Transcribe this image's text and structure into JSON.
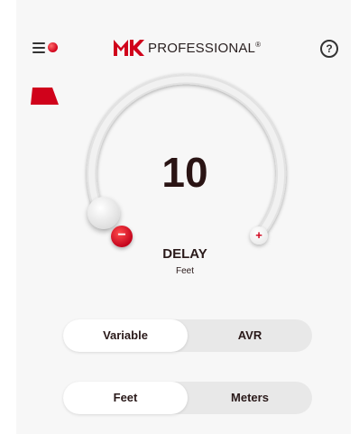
{
  "header": {
    "brand_text": "PROFESSIONAL",
    "brand_reg": "®",
    "help_label": "?",
    "icons": {
      "menu": "hamburger-menu-icon",
      "status": "status-dot-icon",
      "logo": "mk-logo-icon",
      "help": "help-circle-icon",
      "flag": "red-flag-icon"
    }
  },
  "dial": {
    "value": "10",
    "minus_label": "−",
    "plus_label": "+",
    "parameter": "DELAY",
    "unit": "Feet"
  },
  "mode_toggle": {
    "options": [
      "Variable",
      "AVR"
    ],
    "selected": "Variable"
  },
  "units_toggle": {
    "options": [
      "Feet",
      "Meters"
    ],
    "selected": "Feet"
  },
  "colors": {
    "accent": "#d0021b",
    "background": "#f7f7f7",
    "text": "#231a1a"
  }
}
